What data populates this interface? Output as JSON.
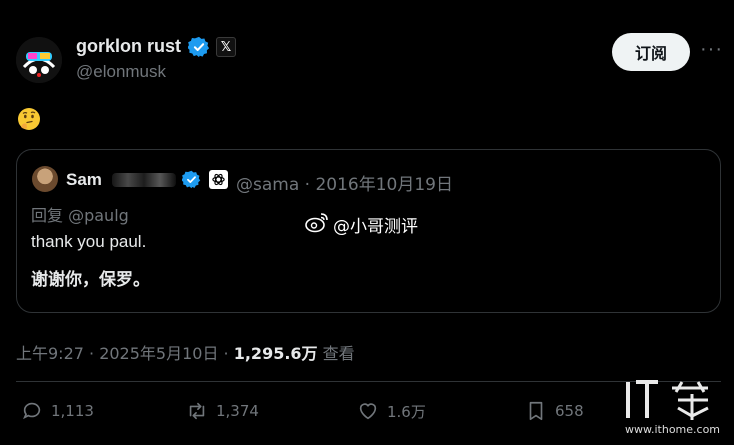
{
  "post": {
    "author_name": "gorklon rust",
    "x_badge": "𝕏",
    "handle": "@elonmusk",
    "subscribe_label": "订阅",
    "more_label": "···",
    "body_emoji": "thinking-face"
  },
  "quoted": {
    "name_visible": "Sam",
    "meta": "@sama · 2016年10月19日",
    "reply_label": "回复 @paulg",
    "text": "thank you paul.",
    "translation": "谢谢你，保罗。"
  },
  "watermark": {
    "weibo_text": "@小哥测评",
    "site": "www.ithome.com"
  },
  "timeline": {
    "time": "上午9:27 · 2025年5月10日 · ",
    "views": "1,295.6万",
    "views_label": " 查看"
  },
  "actions": {
    "replies": "1,113",
    "reposts": "1,374",
    "likes": "1.6万",
    "bookmarks": "658"
  },
  "colors": {
    "background": "#000000",
    "text": "#e7e9ea",
    "muted": "#71767b",
    "verified": "#1d9bf0",
    "border": "#2f3336"
  }
}
